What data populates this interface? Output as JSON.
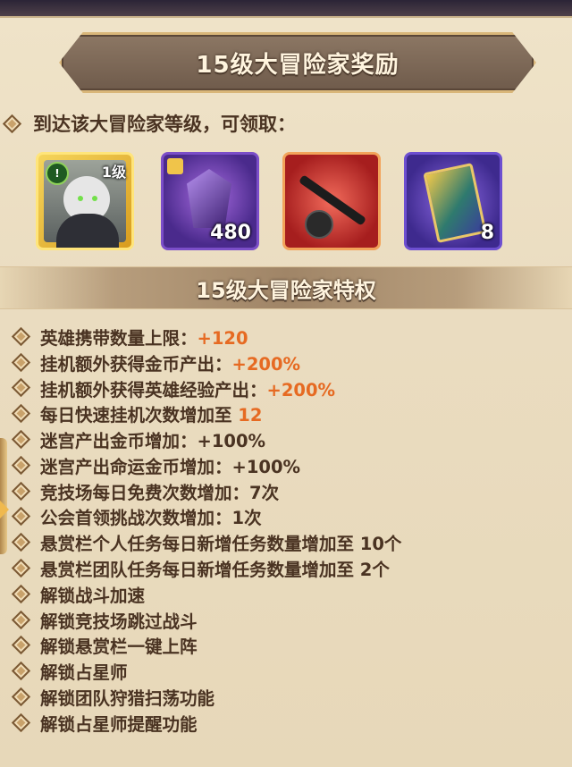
{
  "header": {
    "title": "15级大冒险家奖励",
    "requirement": "到达该大冒险家等级，可领取："
  },
  "rewards": [
    {
      "name": "hero-card",
      "label": "1级"
    },
    {
      "name": "purple-crystal-shard",
      "quantity": "480"
    },
    {
      "name": "dark-weapon",
      "quantity": ""
    },
    {
      "name": "tarot-card",
      "quantity": "8"
    }
  ],
  "privileges": {
    "title": "15级大冒险家特权",
    "items": [
      {
        "label": "英雄携带数量上限：",
        "value": "+120"
      },
      {
        "label": "挂机额外获得金币产出：",
        "value": "+200%"
      },
      {
        "label": "挂机额外获得英雄经验产出：",
        "value": "+200%"
      },
      {
        "label": "每日快速挂机次数增加至 ",
        "value": "12"
      },
      {
        "label": "迷宫产出金币增加：+100%",
        "value": ""
      },
      {
        "label": "迷宫产出命运金币增加：+100%",
        "value": ""
      },
      {
        "label": "竞技场每日免费次数增加：7次",
        "value": ""
      },
      {
        "label": "公会首领挑战次数增加：1次",
        "value": ""
      },
      {
        "label": "悬赏栏个人任务每日新增任务数量增加至 10个",
        "value": ""
      },
      {
        "label": "悬赏栏团队任务每日新增任务数量增加至 2个",
        "value": ""
      },
      {
        "label": "解锁战斗加速",
        "value": ""
      },
      {
        "label": "解锁竞技场跳过战斗",
        "value": ""
      },
      {
        "label": "解锁悬赏栏一键上阵",
        "value": ""
      },
      {
        "label": "解锁占星师",
        "value": ""
      },
      {
        "label": "解锁团队狩猎扫荡功能",
        "value": ""
      },
      {
        "label": "解锁占星师提醒功能",
        "value": ""
      }
    ]
  },
  "colors": {
    "panel": "#e9dcc0",
    "text": "#4a3322",
    "accent": "#e66a22",
    "banner": "#7d6856"
  }
}
